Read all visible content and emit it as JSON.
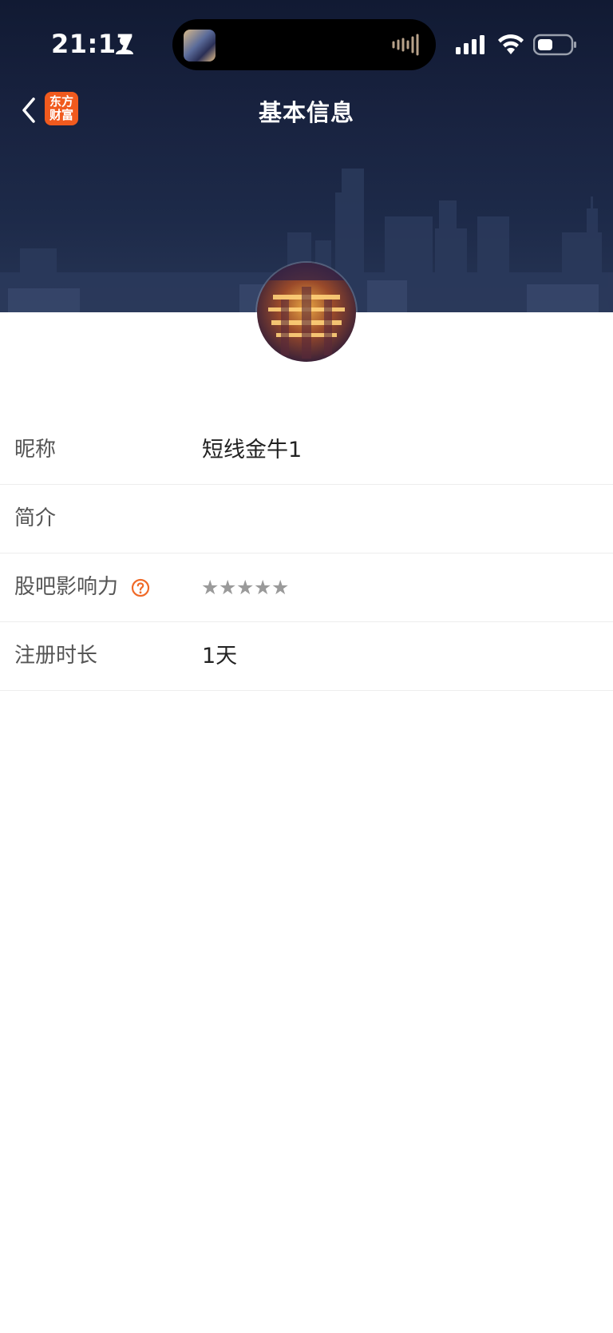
{
  "status_bar": {
    "time": "21:17",
    "icons": [
      "person-icon",
      "signal-icon",
      "wifi-icon",
      "battery-icon"
    ]
  },
  "nav": {
    "title": "基本信息",
    "app_badge_line1": "东方",
    "app_badge_line2": "财富",
    "back_icon": "chevron-left-icon"
  },
  "profile": {
    "rows": [
      {
        "label": "昵称",
        "value": "短线金牛1"
      },
      {
        "label": "简介",
        "value": ""
      },
      {
        "label": "股吧影响力",
        "help_icon": "question-circle-icon",
        "stars": [
          "★",
          "★",
          "★",
          "★",
          "★"
        ],
        "stars_filled": 0
      },
      {
        "label": "注册时长",
        "value": "1天"
      }
    ]
  },
  "colors": {
    "brand": "#f05a1e",
    "header_dark": "#18223f",
    "help_icon": "#f06a28",
    "star_empty": "#9a9a9a"
  }
}
